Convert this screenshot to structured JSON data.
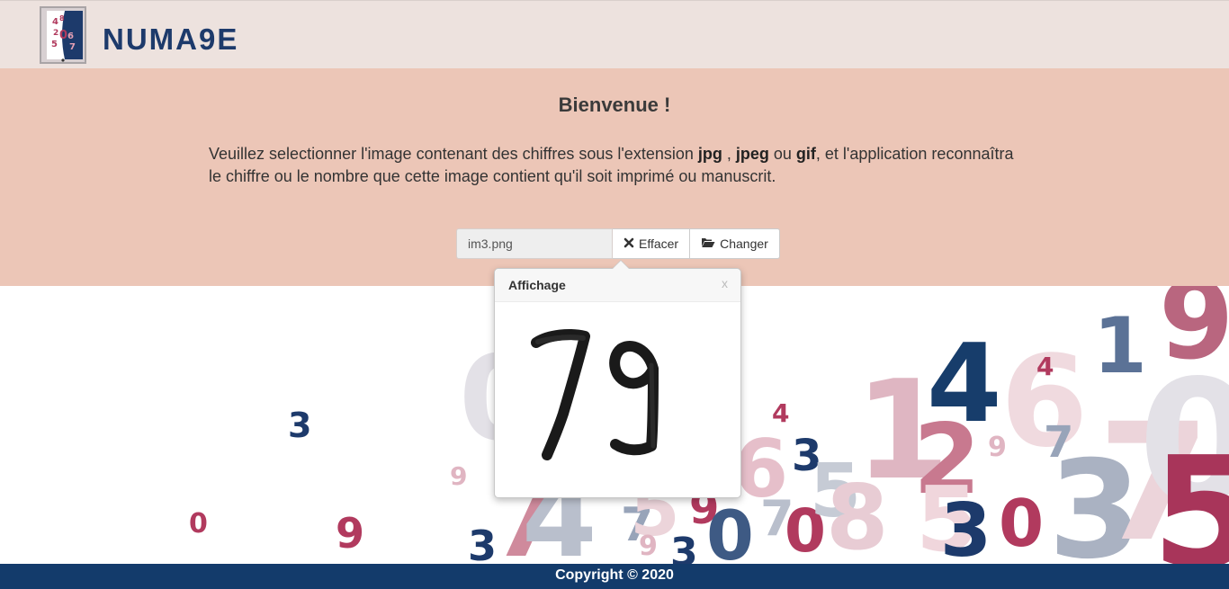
{
  "header": {
    "logo_text": "NUMA9E",
    "logo_digits": [
      "48",
      "20",
      "5",
      "67"
    ]
  },
  "hero": {
    "title": "Bienvenue !",
    "text_1": "Veuillez selectionner l'image contenant des chiffres sous l'extension ",
    "ext_jpg": "jpg",
    "text_2": " , ",
    "ext_jpeg": "jpeg",
    "text_3": " ou ",
    "ext_gif": "gif",
    "text_4": ", et l'application reconnaîtra le chiffre ou le nombre que cette image contient qu'il soit imprimé ou manuscrit."
  },
  "file_input": {
    "value": "im3.png",
    "clear_label": "Effacer",
    "change_label": "Changer",
    "clear_icon": "times-icon",
    "change_icon": "folder-open-icon"
  },
  "preview": {
    "title": "Affichage",
    "close_label": "x",
    "image_digits": "79"
  },
  "footer": {
    "copyright": "Copyright © 2020"
  },
  "colors": {
    "navbar_bg": "#ede2de",
    "hero_bg": "#ecc6b7",
    "footer_bg": "#133b6b",
    "navy": "#1d3a6b",
    "crimson": "#a8355a"
  }
}
